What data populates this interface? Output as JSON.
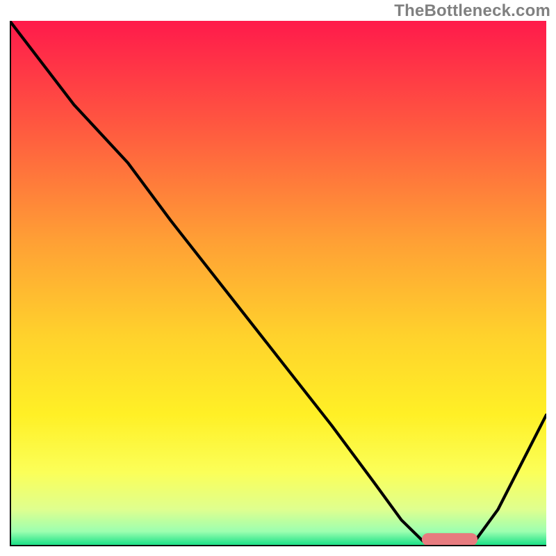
{
  "watermark": "TheBottleneck.com",
  "chart_data": {
    "type": "line",
    "title": "",
    "xlabel": "",
    "ylabel": "",
    "xlim": [
      0,
      100
    ],
    "ylim": [
      0,
      100
    ],
    "grid": false,
    "legend": "none",
    "background_gradient_stops": [
      {
        "offset": 0.0,
        "color": "#ff1a4b"
      },
      {
        "offset": 0.2,
        "color": "#ff5840"
      },
      {
        "offset": 0.42,
        "color": "#ffa035"
      },
      {
        "offset": 0.6,
        "color": "#ffd22c"
      },
      {
        "offset": 0.75,
        "color": "#fff026"
      },
      {
        "offset": 0.86,
        "color": "#fbff59"
      },
      {
        "offset": 0.93,
        "color": "#dfff8f"
      },
      {
        "offset": 0.972,
        "color": "#9cffb0"
      },
      {
        "offset": 0.995,
        "color": "#26e38a"
      },
      {
        "offset": 1.0,
        "color": "#21d683"
      }
    ],
    "series": [
      {
        "name": "bottleneck-curve",
        "color": "#000000",
        "x": [
          0,
          6,
          12,
          22,
          30,
          40,
          50,
          60,
          68,
          73,
          77,
          82,
          86,
          91,
          96,
          100
        ],
        "y": [
          100,
          92,
          84,
          73,
          62,
          49,
          36,
          23,
          12,
          5,
          1,
          0,
          0,
          7,
          17,
          25
        ]
      }
    ],
    "marker": {
      "name": "optimal-range",
      "color": "#e77b7f",
      "x_start": 78,
      "x_end": 86,
      "y": 1.3,
      "thickness": 2.4,
      "cap_radius": 1.2
    },
    "frame_color": "#000000",
    "frame_sides": [
      "left",
      "bottom"
    ]
  }
}
